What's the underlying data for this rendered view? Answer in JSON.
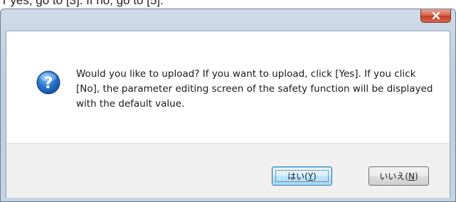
{
  "page_top_text": "r yes, go to [3]. If no, go to [5].",
  "dialog": {
    "close_label": "x",
    "icon": "question-icon",
    "message": "Would you like to upload? If you want to upload, click [Yes]. If you click [No], the parameter editing screen of the safety function will be displayed with the default value.",
    "buttons": {
      "yes": {
        "text": "はい(",
        "mnemonic": "Y",
        "suffix": ")"
      },
      "no": {
        "text": "いいえ(",
        "mnemonic": "N",
        "suffix": ")"
      }
    }
  },
  "colors": {
    "window_frame": "#c5d4e4",
    "close_button": "#c9452b",
    "question_icon": "#1d62b8",
    "default_button_border": "#3c7fb1"
  }
}
